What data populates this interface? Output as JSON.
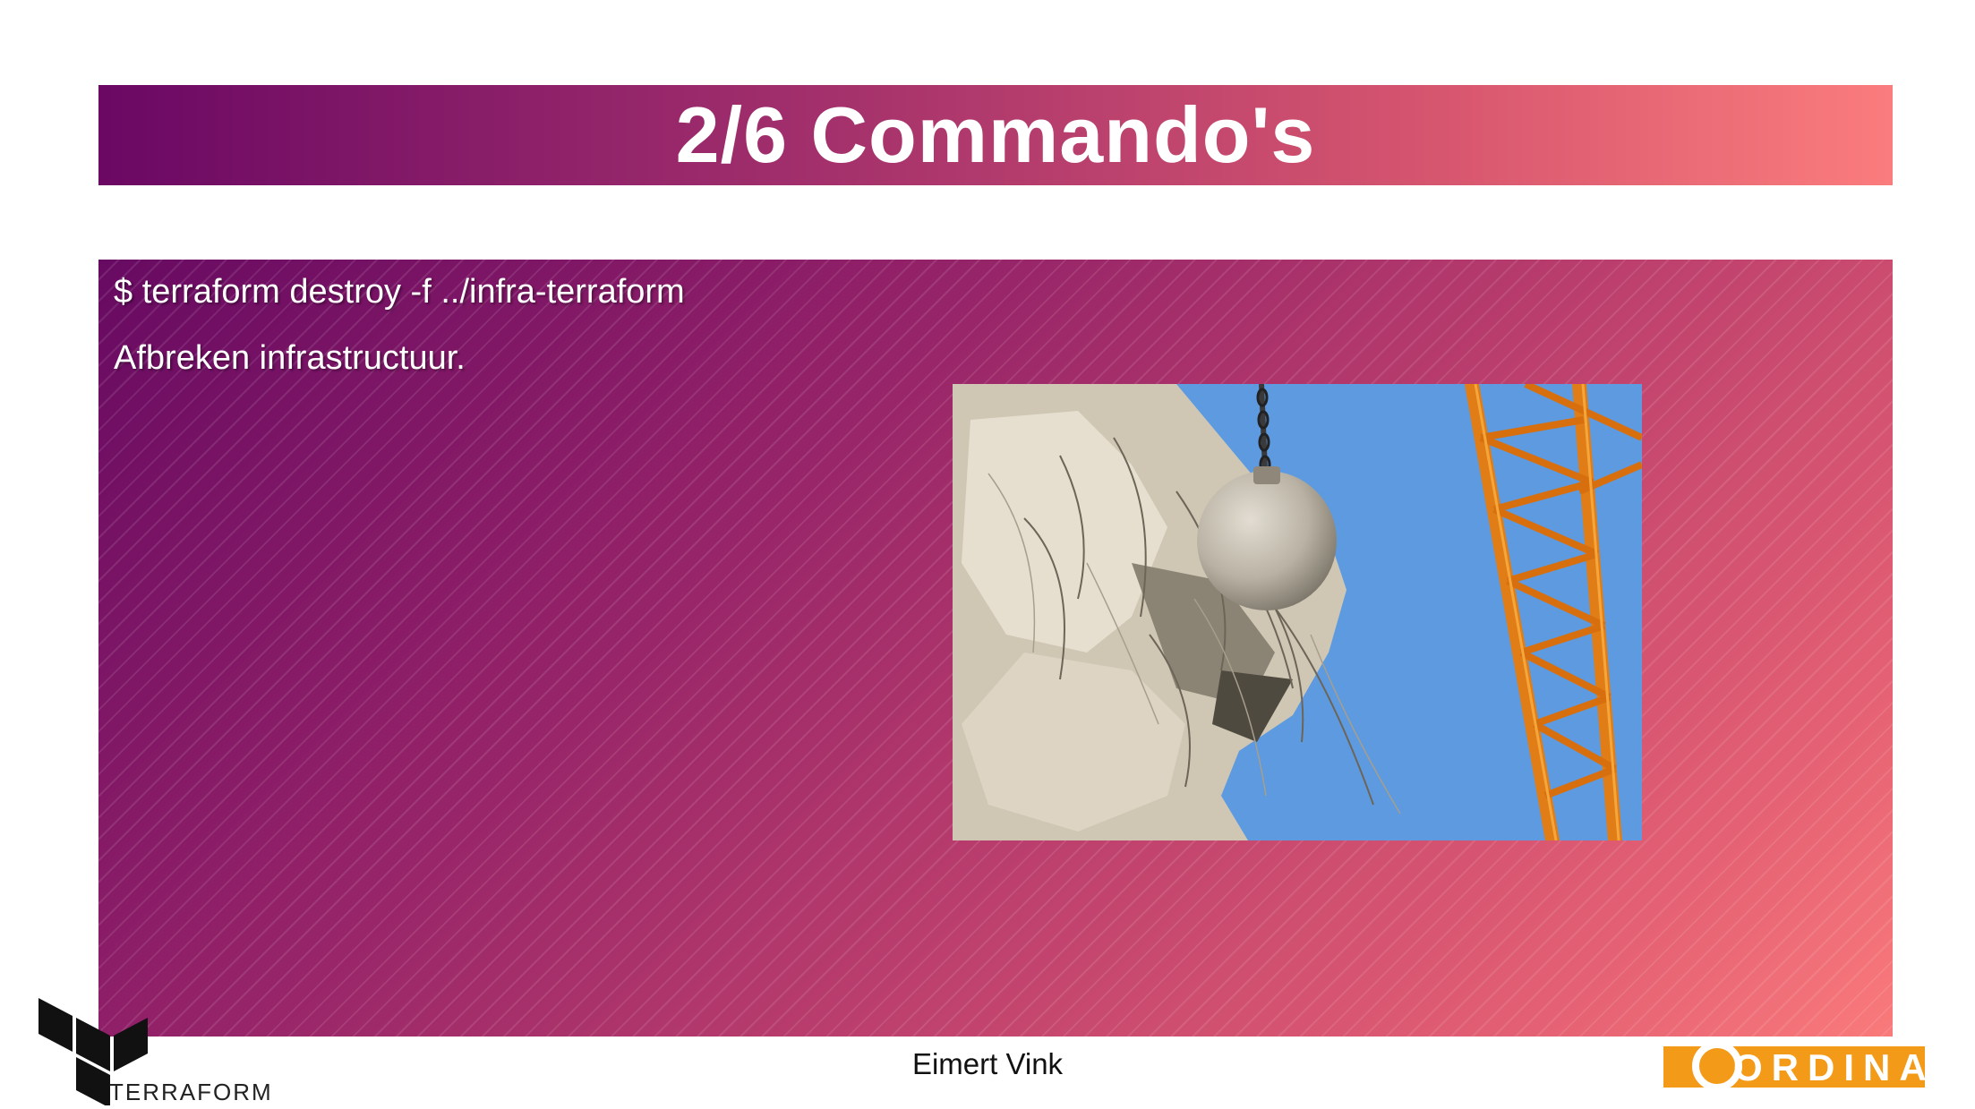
{
  "slide": {
    "title": "2/6 Commando's",
    "command": "$ terraform destroy -f ../infra-terraform",
    "description": "Afbreken infrastructuur.",
    "footer_author": "Eimert Vink"
  },
  "logos": {
    "terraform_wordmark": "TERRAFORM",
    "ordina_wordmark": "ORDINA"
  },
  "colors": {
    "gradient_start": "#6a0864",
    "gradient_end": "#fb7c7d",
    "ordina_orange": "#f39a18",
    "text_light": "#ffffff"
  },
  "image": {
    "subject": "wrecking ball demolishing a concrete building next to an orange crane"
  }
}
